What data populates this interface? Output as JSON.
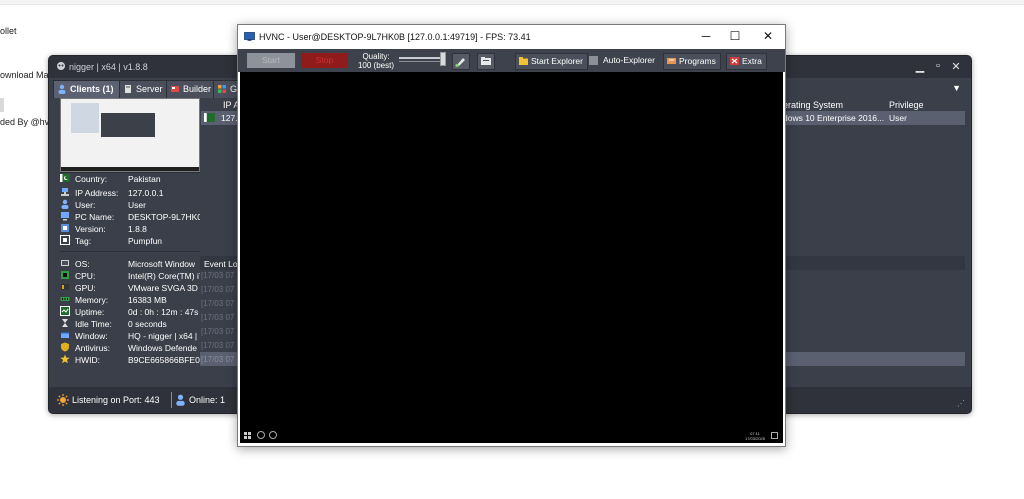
{
  "background": {
    "lines": [
      "ollet",
      "ownload Mar",
      "ded By @hvn"
    ]
  },
  "rat": {
    "title": "nigger | x64 | v1.8.8",
    "tabs": [
      {
        "label": "Clients (1)",
        "icon": "users-icon"
      },
      {
        "label": "Server",
        "icon": "server-icon"
      },
      {
        "label": "Builder",
        "icon": "builder-icon"
      },
      {
        "label": "Gr",
        "icon": "grid-icon"
      }
    ],
    "columns": {
      "ip": "IP A",
      "os": "erating System",
      "privilege": "Privilege"
    },
    "row": {
      "ip": "127.",
      "os": "dows 10 Enterprise 2016...",
      "privilege": "User"
    },
    "info": [
      {
        "label": "Country:",
        "value": "Pakistan",
        "icon": "flag-icon"
      },
      {
        "label": "IP Address:",
        "value": "127.0.0.1",
        "icon": "network-icon"
      },
      {
        "label": "User:",
        "value": "User",
        "icon": "user-icon"
      },
      {
        "label": "PC Name:",
        "value": "DESKTOP-9L7HK0B",
        "icon": "computer-icon"
      },
      {
        "label": "Version:",
        "value": "1.8.8",
        "icon": "version-icon"
      },
      {
        "label": "Tag:",
        "value": "Pumpfun",
        "icon": "tag-icon"
      }
    ],
    "system": [
      {
        "label": "OS:",
        "value": "Microsoft Window",
        "icon": "os-icon"
      },
      {
        "label": "CPU:",
        "value": "Intel(R) Core(TM) i7",
        "icon": "cpu-icon"
      },
      {
        "label": "GPU:",
        "value": "VMware SVGA 3D",
        "icon": "gpu-icon"
      },
      {
        "label": "Memory:",
        "value": "16383 MB",
        "icon": "memory-icon"
      },
      {
        "label": "Uptime:",
        "value": "0d : 0h : 12m : 47s",
        "icon": "uptime-icon"
      },
      {
        "label": "Idle Time:",
        "value": "0 seconds",
        "icon": "hourglass-icon"
      },
      {
        "label": "Window:",
        "value": "HQ - nigger | x64 |",
        "icon": "window-icon"
      },
      {
        "label": "Antivirus:",
        "value": "Windows Defende",
        "icon": "shield-icon"
      },
      {
        "label": "HWID:",
        "value": "B9CE665866BFE03",
        "icon": "star-icon"
      }
    ],
    "event_log": {
      "label": "Event Lo",
      "entries": [
        "[17/03 07",
        "[17/03 07",
        "[17/03 07",
        "[17/03 07",
        "[17/03 07",
        "[17/03 07",
        "[17/03 07",
        "[17/03 07"
      ]
    },
    "status": {
      "listening": "Listening on Port: 443",
      "online": "Online: 1"
    }
  },
  "hvnc": {
    "title": "HVNC - User@DESKTOP-9L7HK0B [127.0.0.1:49719] - FPS: 73.41",
    "start": "Start",
    "stop": "Stop",
    "quality_label": "Quality:",
    "quality_value": "100 (best)",
    "quality_level": 1.0,
    "start_explorer": "Start Explorer",
    "auto_explorer": "Auto-Explorer",
    "programs": "Programs",
    "extra": "Extra",
    "clock_time": "07:11",
    "clock_date": "17/03/2025"
  },
  "colors": {
    "rat_bg": "#3b3f4a",
    "selection": "#5a6070",
    "stop_red": "#8f1b1b"
  }
}
